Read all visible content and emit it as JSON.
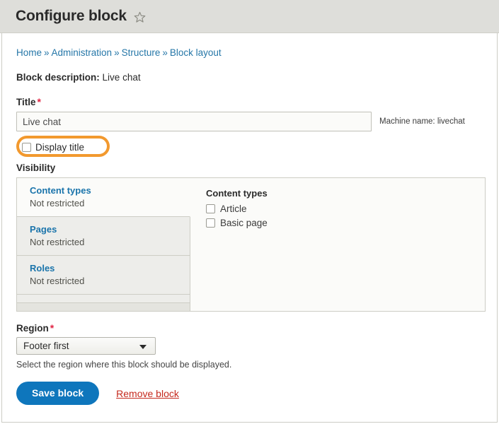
{
  "header": {
    "title": "Configure block",
    "star_icon": "star-outline-icon"
  },
  "breadcrumb": {
    "separator": "»",
    "items": [
      {
        "label": "Home"
      },
      {
        "label": "Administration"
      },
      {
        "label": "Structure"
      },
      {
        "label": "Block layout"
      }
    ]
  },
  "block_description": {
    "label": "Block description:",
    "value": "Live chat"
  },
  "title_field": {
    "label": "Title",
    "required_marker": "*",
    "value": "Live chat",
    "placeholder": "",
    "machine_name": "Machine name: livechat"
  },
  "display_title": {
    "label": "Display title",
    "checked": false,
    "annotation_color": "#f2992e"
  },
  "visibility": {
    "label": "Visibility",
    "tabs": [
      {
        "title": "Content types",
        "summary": "Not restricted",
        "active": true
      },
      {
        "title": "Pages",
        "summary": "Not restricted",
        "active": false
      },
      {
        "title": "Roles",
        "summary": "Not restricted",
        "active": false
      }
    ],
    "pane": {
      "heading": "Content types",
      "checkboxes": [
        {
          "label": "Article",
          "checked": false
        },
        {
          "label": "Basic page",
          "checked": false
        }
      ]
    }
  },
  "region": {
    "label": "Region",
    "required_marker": "*",
    "selected": "Footer first",
    "help": "Select the region where this block should be displayed."
  },
  "actions": {
    "save_label": "Save block",
    "remove_label": "Remove block"
  },
  "colors": {
    "header_bg": "#dededa",
    "link": "#2677a8",
    "tab_link": "#1a74ab",
    "primary_button": "#0e76bc",
    "danger_link": "#c5281c",
    "required": "#e02443",
    "annotation": "#f2992e"
  }
}
